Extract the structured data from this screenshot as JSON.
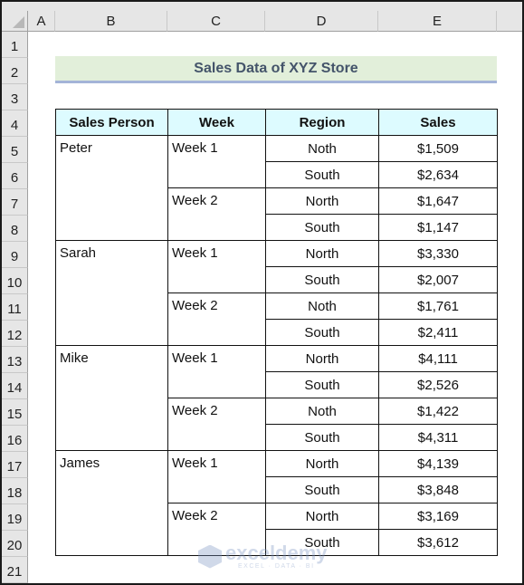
{
  "spreadsheet": {
    "column_headers": [
      "A",
      "B",
      "C",
      "D",
      "E"
    ],
    "row_headers": [
      "1",
      "2",
      "3",
      "4",
      "5",
      "6",
      "7",
      "8",
      "9",
      "10",
      "11",
      "12",
      "13",
      "14",
      "15",
      "16",
      "17",
      "18",
      "19",
      "20",
      "21"
    ]
  },
  "title": "Sales Data of XYZ Store",
  "table": {
    "headers": [
      "Sales Person",
      "Week",
      "Region",
      "Sales"
    ],
    "persons": [
      {
        "name": "Peter",
        "weeks": [
          {
            "week": "Week 1",
            "rows": [
              {
                "region": "Noth",
                "sales": "$1,509"
              },
              {
                "region": "South",
                "sales": "$2,634"
              }
            ]
          },
          {
            "week": "Week 2",
            "rows": [
              {
                "region": "North",
                "sales": "$1,647"
              },
              {
                "region": "South",
                "sales": "$1,147"
              }
            ]
          }
        ]
      },
      {
        "name": "Sarah",
        "weeks": [
          {
            "week": "Week 1",
            "rows": [
              {
                "region": "North",
                "sales": "$3,330"
              },
              {
                "region": "South",
                "sales": "$2,007"
              }
            ]
          },
          {
            "week": "Week 2",
            "rows": [
              {
                "region": "Noth",
                "sales": "$1,761"
              },
              {
                "region": "South",
                "sales": "$2,411"
              }
            ]
          }
        ]
      },
      {
        "name": "Mike",
        "weeks": [
          {
            "week": "Week 1",
            "rows": [
              {
                "region": "North",
                "sales": "$4,111"
              },
              {
                "region": "South",
                "sales": "$2,526"
              }
            ]
          },
          {
            "week": "Week 2",
            "rows": [
              {
                "region": "Noth",
                "sales": "$1,422"
              },
              {
                "region": "South",
                "sales": "$4,311"
              }
            ]
          }
        ]
      },
      {
        "name": "James",
        "weeks": [
          {
            "week": "Week 1",
            "rows": [
              {
                "region": "North",
                "sales": "$4,139"
              },
              {
                "region": "South",
                "sales": "$3,848"
              }
            ]
          },
          {
            "week": "Week 2",
            "rows": [
              {
                "region": "North",
                "sales": "$3,169"
              },
              {
                "region": "South",
                "sales": "$3,612"
              }
            ]
          }
        ]
      }
    ]
  },
  "watermark": {
    "main": "exceldemy",
    "sub": "EXCEL · DATA · BI"
  },
  "colors": {
    "title_fill": "#e2efda",
    "title_text": "#44546a",
    "title_underline": "#a4b4d8",
    "header_fill": "#ddfbff"
  }
}
